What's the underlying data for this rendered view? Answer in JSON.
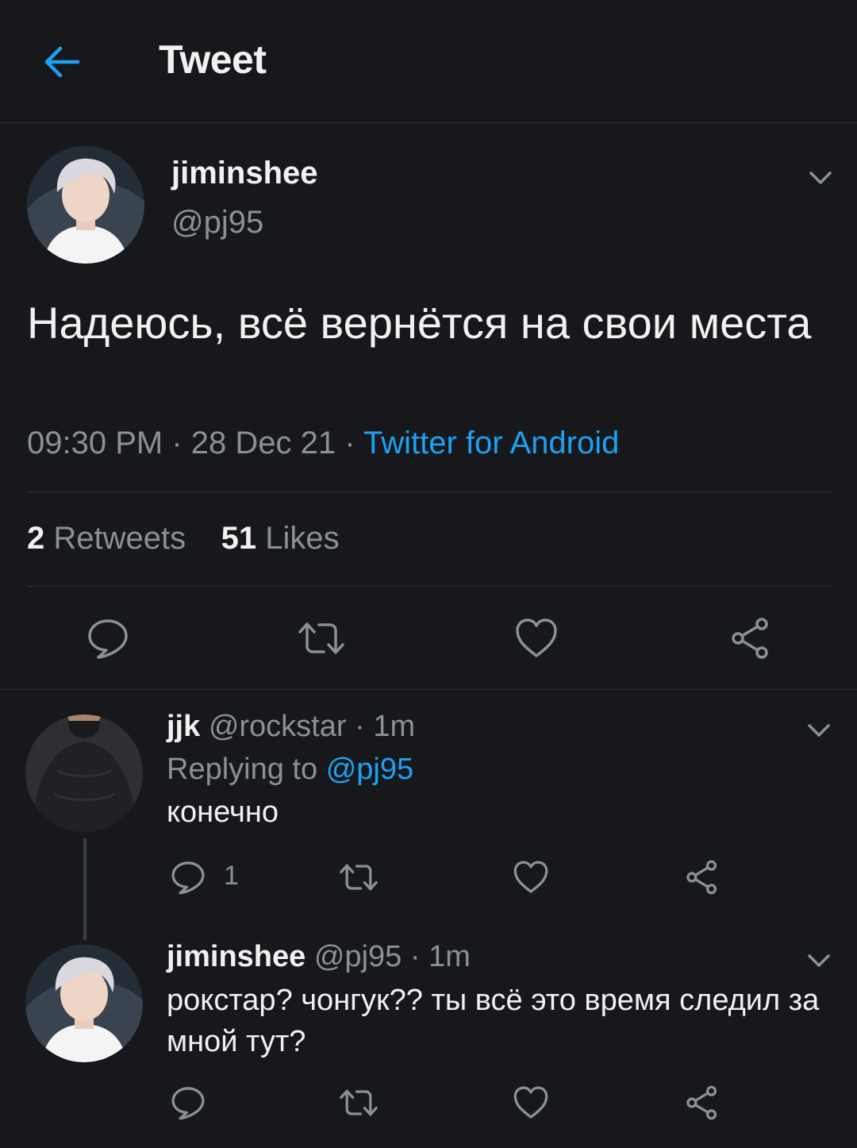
{
  "header": {
    "title": "Tweet"
  },
  "tweet": {
    "name": "jiminshee",
    "handle": "@pj95",
    "text": "Надеюсь, всё вернётся на свои места",
    "time": "09:30 PM",
    "date": "28 Dec 21",
    "source": "Twitter for Android",
    "sep": "·",
    "retweets_count": "2",
    "retweets_label": "Retweets",
    "likes_count": "51",
    "likes_label": "Likes"
  },
  "replies": [
    {
      "name": "jjk",
      "handle": "@rockstar",
      "time": "1m",
      "replying_prefix": "Replying to",
      "replying_to": "@pj95",
      "text": "конечно",
      "reply_count": "1"
    },
    {
      "name": "jiminshee",
      "handle": "@pj95",
      "time": "1m",
      "text": "рокстар? чонгук?? ты всё это время следил за мной тут?"
    }
  ],
  "colors": {
    "background": "#17181c",
    "accent": "#1da1f2",
    "muted": "#8b9096",
    "text": "#e8eaed"
  },
  "icons": [
    "back-arrow-icon",
    "chevron-down-icon",
    "reply-icon",
    "retweet-icon",
    "like-icon",
    "share-icon"
  ]
}
